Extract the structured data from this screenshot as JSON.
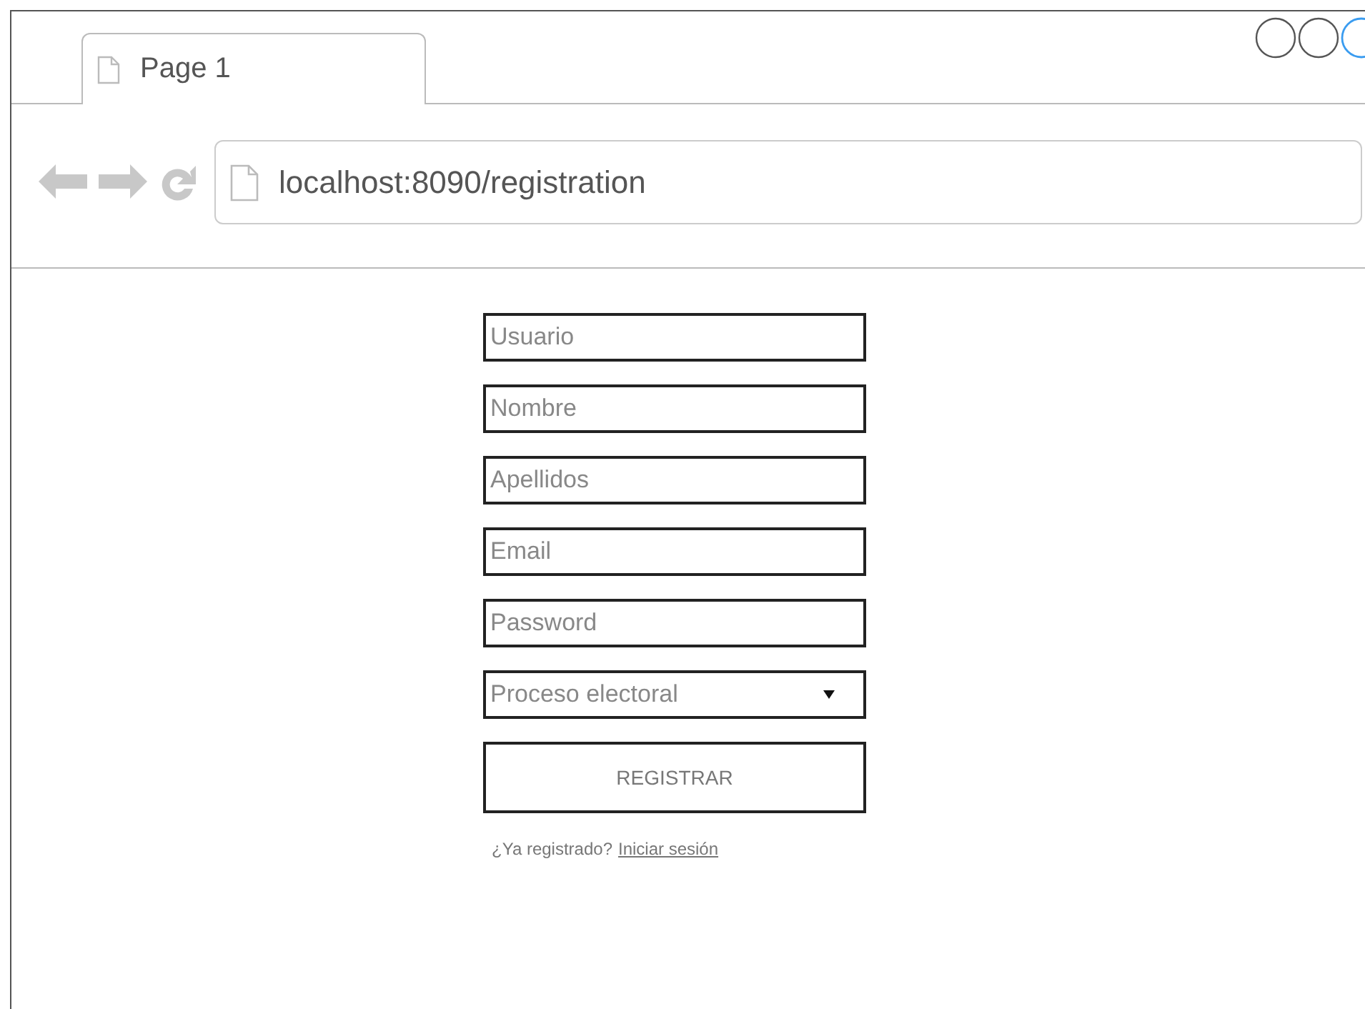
{
  "browser": {
    "tab": {
      "label": "Page 1"
    },
    "address": "localhost:8090/registration"
  },
  "form": {
    "fields": [
      {
        "kind": "text",
        "placeholder": "Usuario"
      },
      {
        "kind": "text",
        "placeholder": "Nombre"
      },
      {
        "kind": "text",
        "placeholder": "Apellidos"
      },
      {
        "kind": "text",
        "placeholder": "Email"
      },
      {
        "kind": "password",
        "placeholder": "Password"
      },
      {
        "kind": "select",
        "placeholder": "Proceso electoral"
      }
    ],
    "submit": "REGISTRAR",
    "login_prompt": "¿Ya registrado?",
    "login_link": "Iniciar sesión"
  }
}
